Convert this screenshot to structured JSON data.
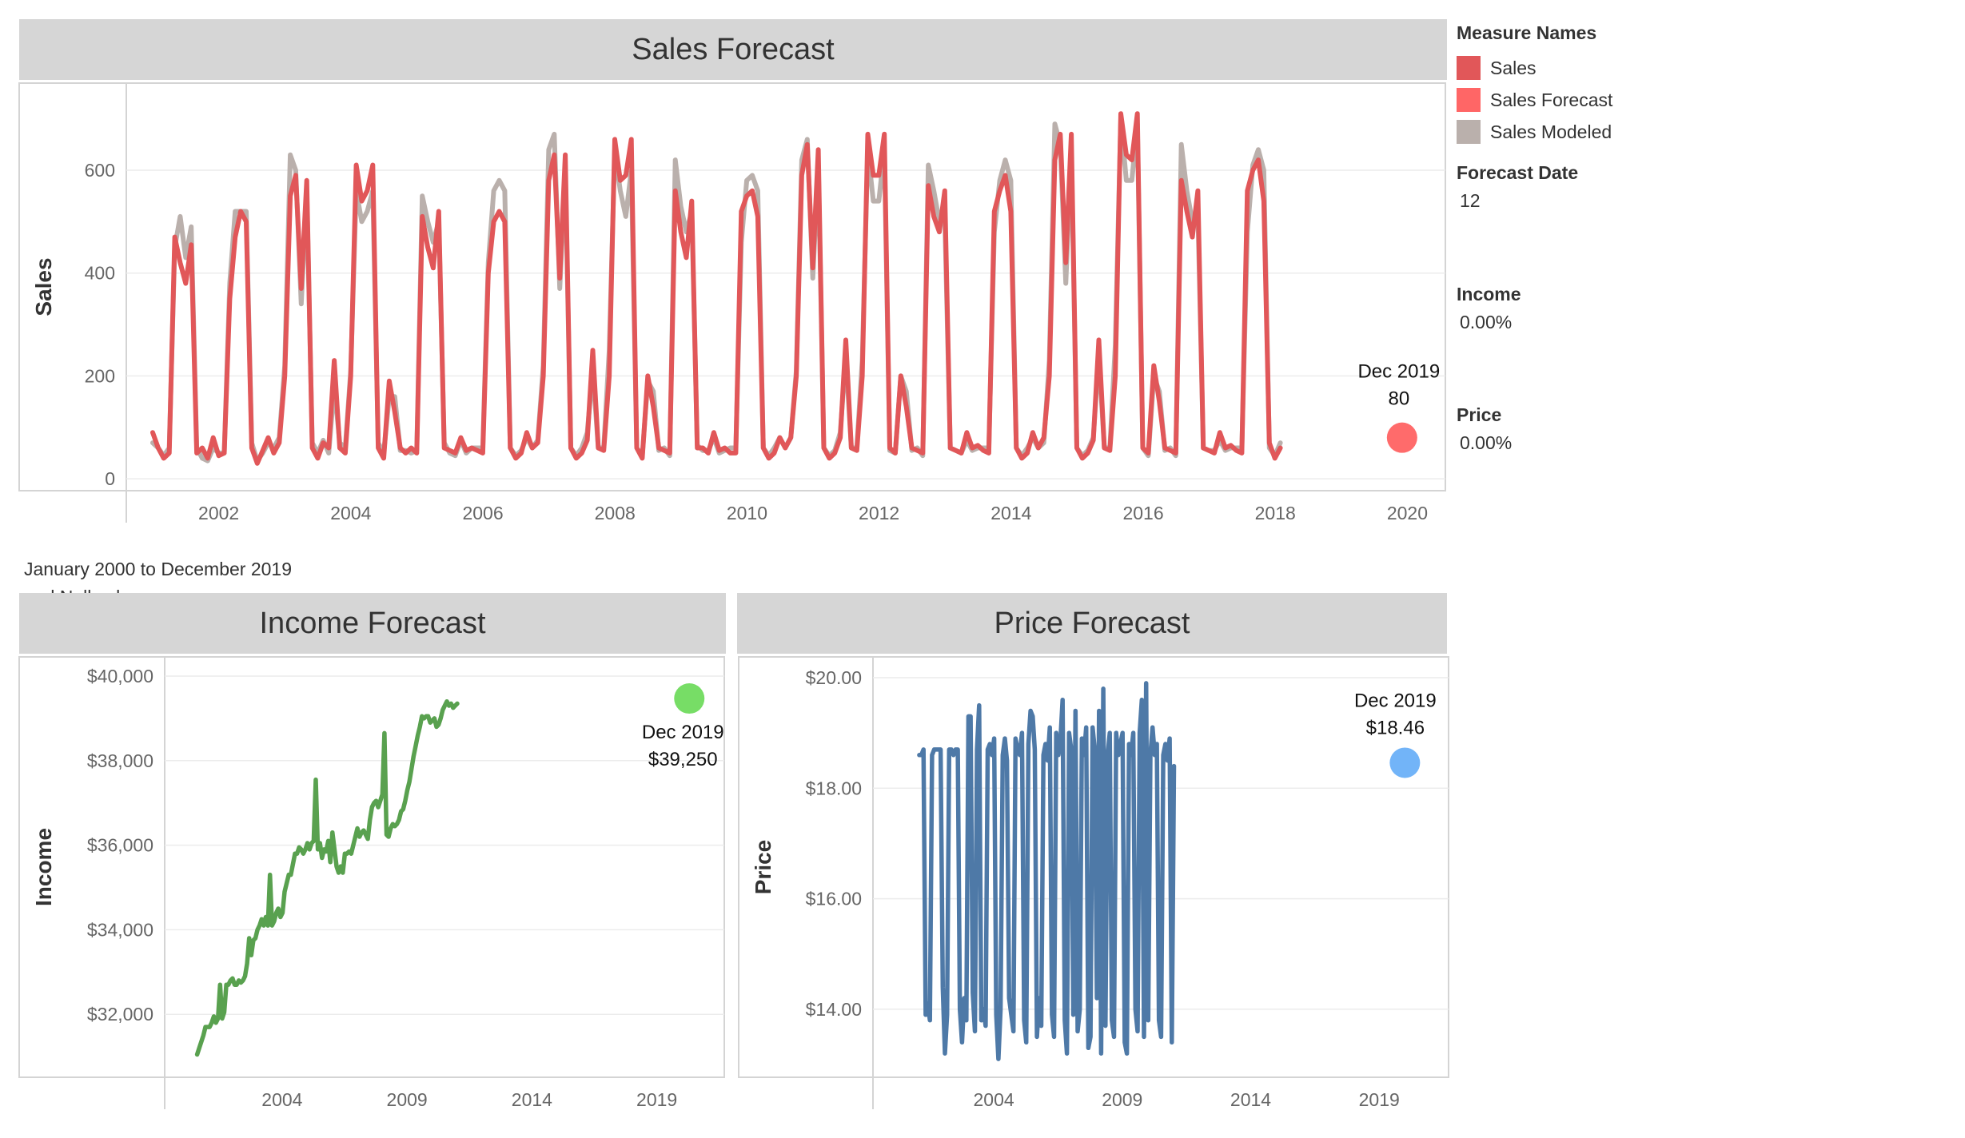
{
  "caption": {
    "line1": "January 2000 to December 2019",
    "line2": "and Null values"
  },
  "legend": {
    "title": "Measure Names",
    "items": [
      {
        "label": "Sales",
        "color": "#e15759"
      },
      {
        "label": "Sales Forecast",
        "color": "#ff6666"
      },
      {
        "label": "Sales Modeled",
        "color": "#bab0ac"
      }
    ]
  },
  "parameters": [
    {
      "label": "Forecast Date",
      "value": "12"
    },
    {
      "label": "Income",
      "value": "0.00%"
    },
    {
      "label": "Price",
      "value": "0.00%"
    }
  ],
  "colors": {
    "sales": "#e15759",
    "sales_modeled": "#bab0ac",
    "sales_forecast": "#ff6b6b",
    "income": "#59a14f",
    "income_forecast": "#77dd66",
    "price": "#4e79a7",
    "price_forecast": "#72b4f8",
    "title_bar": "#d6d6d6"
  },
  "chart_data": [
    {
      "type": "line",
      "title": "Sales Forecast",
      "ylabel": "Sales",
      "xlabel": "",
      "xlim": [
        2000.6,
        2020.6
      ],
      "ylim": [
        -20,
        760
      ],
      "yticks": [
        0,
        200,
        400,
        600
      ],
      "ytick_labels": [
        "0",
        "200",
        "400",
        "600"
      ],
      "xticks": [
        2002,
        2004,
        2006,
        2008,
        2010,
        2012,
        2014,
        2016,
        2018,
        2020
      ],
      "xtick_labels": [
        "2002",
        "2004",
        "2006",
        "2008",
        "2010",
        "2012",
        "2014",
        "2016",
        "2018",
        "2020"
      ],
      "grid": true,
      "series": [
        {
          "name": "Sales",
          "start": 2001.0,
          "step": 0.0833,
          "values": [
            90,
            60,
            40,
            50,
            470,
            420,
            380,
            455,
            50,
            60,
            40,
            80,
            45,
            50,
            350,
            470,
            520,
            500,
            60,
            30,
            55,
            80,
            50,
            70,
            200,
            550,
            590,
            370,
            580,
            60,
            40,
            70,
            60,
            230,
            60,
            50,
            200,
            610,
            540,
            560,
            610,
            60,
            40,
            190,
            130,
            60,
            50,
            60,
            50,
            510,
            450,
            410,
            520,
            60,
            55,
            50,
            80,
            55,
            60,
            55,
            50,
            400,
            500,
            520,
            500,
            60,
            40,
            50,
            90,
            60,
            70,
            200,
            580,
            630,
            390,
            630,
            60,
            40,
            50,
            75,
            250,
            60,
            55,
            200,
            660,
            580,
            590,
            660,
            60,
            40,
            200,
            140,
            60,
            55,
            50,
            560,
            480,
            430,
            540,
            60,
            60,
            50,
            90,
            55,
            60,
            50,
            50,
            520,
            550,
            560,
            510,
            60,
            40,
            50,
            80,
            60,
            80,
            200,
            590,
            650,
            410,
            640,
            60,
            40,
            50,
            80,
            270,
            60,
            55,
            200,
            670,
            590,
            590,
            670,
            60,
            50,
            200,
            140,
            60,
            55,
            50,
            570,
            510,
            480,
            560,
            60,
            55,
            50,
            90,
            60,
            65,
            55,
            50,
            520,
            560,
            590,
            520,
            60,
            40,
            50,
            90,
            60,
            80,
            200,
            620,
            670,
            420,
            670,
            60,
            40,
            50,
            75,
            270,
            60,
            55,
            200,
            710,
            630,
            620,
            710,
            60,
            50,
            220,
            150,
            60,
            55,
            50,
            580,
            520,
            470,
            560,
            60,
            55,
            50,
            90,
            60,
            65,
            55,
            50,
            560,
            600,
            620,
            540,
            70,
            40,
            60
          ]
        },
        {
          "name": "Sales Modeled",
          "start": 2001.0,
          "step": 0.0833,
          "values": [
            70,
            60,
            45,
            60,
            450,
            510,
            430,
            490,
            60,
            40,
            35,
            60,
            50,
            50,
            380,
            520,
            520,
            520,
            70,
            35,
            50,
            70,
            60,
            80,
            220,
            630,
            600,
            340,
            560,
            70,
            50,
            75,
            50,
            180,
            70,
            60,
            210,
            560,
            500,
            520,
            560,
            70,
            50,
            160,
            160,
            55,
            55,
            50,
            55,
            550,
            500,
            460,
            500,
            70,
            50,
            45,
            75,
            50,
            60,
            60,
            60,
            420,
            560,
            580,
            560,
            60,
            45,
            55,
            80,
            60,
            75,
            220,
            640,
            670,
            370,
            600,
            60,
            45,
            60,
            90,
            210,
            60,
            60,
            250,
            640,
            560,
            510,
            600,
            60,
            45,
            190,
            170,
            55,
            60,
            45,
            620,
            530,
            480,
            520,
            65,
            55,
            55,
            80,
            50,
            55,
            60,
            60,
            460,
            580,
            590,
            560,
            60,
            45,
            60,
            80,
            60,
            80,
            210,
            620,
            660,
            390,
            610,
            60,
            45,
            55,
            90,
            240,
            60,
            60,
            230,
            640,
            540,
            540,
            640,
            55,
            50,
            200,
            170,
            55,
            60,
            45,
            610,
            560,
            500,
            510,
            60,
            55,
            50,
            75,
            55,
            60,
            60,
            60,
            480,
            580,
            620,
            580,
            60,
            45,
            60,
            80,
            60,
            70,
            230,
            690,
            650,
            380,
            640,
            60,
            45,
            55,
            80,
            240,
            60,
            60,
            260,
            700,
            580,
            580,
            690,
            60,
            45,
            200,
            170,
            55,
            60,
            45,
            650,
            560,
            500,
            520,
            60,
            55,
            55,
            75,
            55,
            60,
            60,
            60,
            480,
            610,
            640,
            600,
            60,
            45,
            70
          ]
        }
      ],
      "forecast": {
        "x": 2019.92,
        "y": 80,
        "label_line1": "Dec 2019",
        "label_line2": "80"
      }
    },
    {
      "type": "line",
      "title": "Income Forecast",
      "ylabel": "Income",
      "xlabel": "",
      "xlim": [
        1999.3,
        2021.7
      ],
      "ylim": [
        30700,
        40000
      ],
      "yticks": [
        32000,
        34000,
        36000,
        38000,
        40000
      ],
      "ytick_labels": [
        "$32,000",
        "$34,000",
        "$36,000",
        "$38,000",
        "$40,000"
      ],
      "xticks": [
        2004,
        2009,
        2014,
        2019
      ],
      "xtick_labels": [
        "2004",
        "2009",
        "2014",
        "2019"
      ],
      "grid": true,
      "series": [
        {
          "name": "Income",
          "start": 2000.6,
          "step": 0.0833,
          "values": [
            31050,
            31200,
            31350,
            31500,
            31700,
            31700,
            31700,
            31800,
            31950,
            31800,
            31900,
            32700,
            31900,
            32050,
            32700,
            32700,
            32800,
            32850,
            32700,
            32700,
            32800,
            32750,
            32800,
            32900,
            33200,
            33800,
            33400,
            33750,
            33800,
            34000,
            34100,
            34250,
            34100,
            34300,
            34100,
            35300,
            34100,
            34200,
            34400,
            34500,
            34300,
            34400,
            34900,
            35100,
            35300,
            35300,
            35550,
            35800,
            35800,
            35950,
            35900,
            35800,
            35900,
            36050,
            35900,
            36050,
            36100,
            37550,
            35900,
            36050,
            35700,
            35900,
            35850,
            36100,
            35600,
            36300,
            35900,
            35500,
            35350,
            35500,
            35350,
            35800,
            35800,
            35850,
            35800,
            36000,
            36200,
            36400,
            36200,
            36300,
            36350,
            36250,
            36150,
            36600,
            36900,
            37000,
            37050,
            36900,
            37050,
            37200,
            38650,
            36250,
            36200,
            36400,
            36500,
            36450,
            36500,
            36600,
            36800,
            36850,
            37050,
            37300,
            37500,
            37800,
            38100,
            38350,
            38600,
            38800,
            39050,
            39000,
            39050,
            39050,
            38900,
            38950,
            39000,
            38800,
            38850,
            39000,
            39200,
            39300,
            39400,
            39300,
            39350,
            39250,
            39300,
            39350
          ]
        }
      ],
      "forecast": {
        "x": 2020.3,
        "y": 39470,
        "label_line1": "Dec 2019",
        "label_line2": "$39,250"
      }
    },
    {
      "type": "line",
      "title": "Price Forecast",
      "ylabel": "Price",
      "xlabel": "",
      "xlim": [
        1999.3,
        2021.7
      ],
      "ylim": [
        13.0,
        20.0
      ],
      "yticks": [
        14.0,
        16.0,
        18.0,
        20.0
      ],
      "ytick_labels": [
        "$14.00",
        "$16.00",
        "$18.00",
        "$20.00"
      ],
      "xticks": [
        2004,
        2009,
        2014,
        2019
      ],
      "xtick_labels": [
        "2004",
        "2009",
        "2014",
        "2019"
      ],
      "grid": true,
      "series": [
        {
          "name": "Price",
          "start": 2001.1,
          "step": 0.0833,
          "values": [
            18.6,
            18.6,
            18.7,
            13.9,
            14.1,
            13.8,
            18.6,
            18.7,
            18.7,
            18.7,
            18.7,
            14.4,
            13.2,
            13.9,
            18.7,
            18.7,
            18.6,
            18.7,
            18.7,
            14.0,
            13.4,
            14.2,
            13.8,
            19.3,
            19.3,
            14.3,
            13.6,
            18.7,
            19.5,
            13.8,
            14.0,
            13.7,
            18.7,
            18.8,
            18.6,
            18.9,
            13.9,
            13.1,
            14.0,
            18.6,
            18.9,
            18.5,
            14.2,
            13.9,
            13.6,
            18.9,
            18.7,
            18.6,
            19.0,
            13.8,
            13.4,
            18.8,
            19.4,
            19.3,
            18.7,
            13.5,
            14.2,
            13.7,
            18.6,
            18.8,
            18.5,
            19.1,
            13.9,
            13.5,
            19.0,
            18.6,
            18.9,
            19.6,
            13.8,
            13.2,
            19.0,
            18.7,
            13.9,
            19.4,
            13.6,
            14.0,
            18.9,
            18.6,
            19.1,
            13.3,
            13.5,
            19.1,
            18.7,
            14.2,
            19.4,
            13.2,
            19.8,
            13.7,
            18.6,
            19.0,
            13.8,
            13.5,
            19.0,
            18.6,
            18.8,
            19.0,
            13.4,
            13.2,
            18.8,
            18.6,
            19.0,
            14.0,
            13.6,
            19.0,
            19.6,
            13.5,
            19.9,
            13.8,
            18.6,
            19.1,
            18.6,
            18.8,
            13.8,
            13.5,
            18.6,
            18.8,
            18.5,
            18.9,
            13.4,
            18.4
          ]
        }
      ],
      "forecast": {
        "x": 2020.0,
        "y": 18.46,
        "label_line1": "Dec 2019",
        "label_line2": "$18.46"
      }
    }
  ]
}
